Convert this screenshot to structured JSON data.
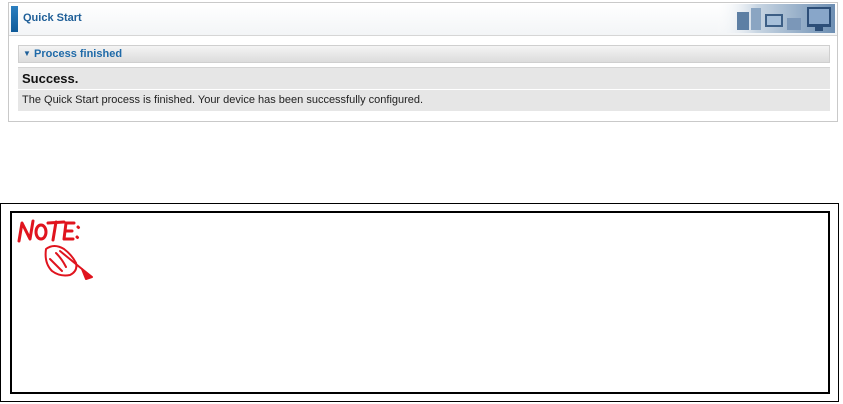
{
  "quick_start": {
    "title": "Quick Start",
    "section_title": "Process finished",
    "status_heading": "Success.",
    "status_message": "The Quick Start process is finished. Your device has been successfully configured."
  },
  "note": {
    "logo_text": "NOTE:",
    "logo_icon": "hand-writing-icon"
  },
  "colors": {
    "accent": "#1f5f98",
    "row_background": "#e6e6e6",
    "note_red": "#e0141e"
  }
}
